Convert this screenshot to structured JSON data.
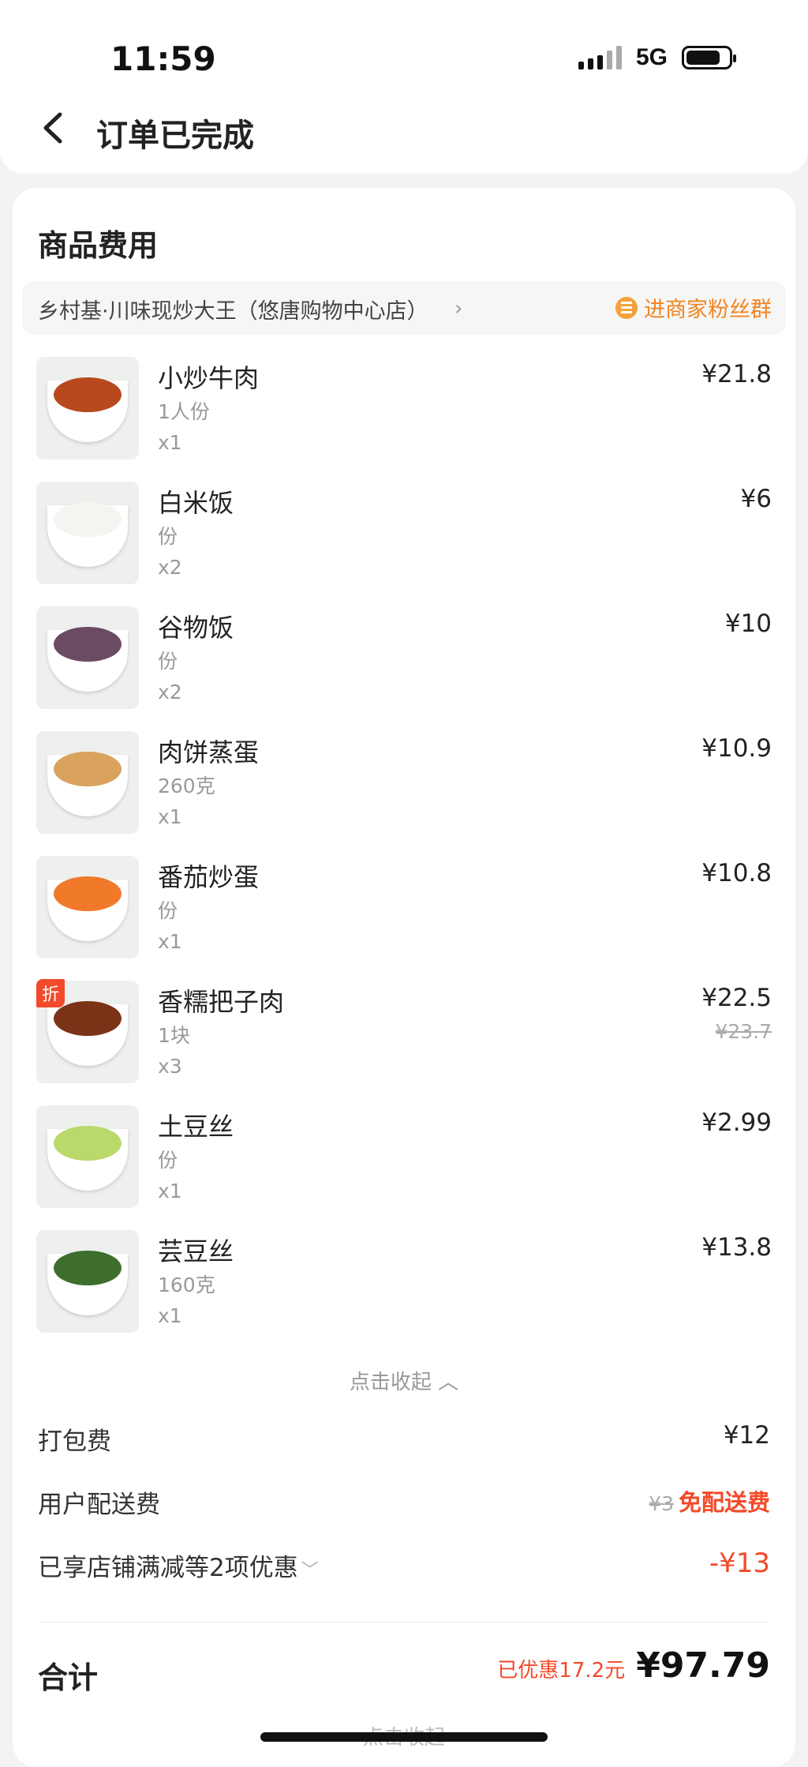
{
  "status_bar": {
    "time": "11:59",
    "network": "5G"
  },
  "nav": {
    "title": "订单已完成"
  },
  "section": {
    "title": "商品费用"
  },
  "shop": {
    "name": "乡村基·川味现炒大王（悠唐购物中心店）",
    "fans_link": "进商家粉丝群"
  },
  "items": [
    {
      "name": "小炒牛肉",
      "spec": "1人份",
      "qty": "x1",
      "price": "¥21.8",
      "food_color": "#b8491f"
    },
    {
      "name": "白米饭",
      "spec": "份",
      "qty": "x2",
      "price": "¥6",
      "food_color": "#f4f4f0"
    },
    {
      "name": "谷物饭",
      "spec": "份",
      "qty": "x2",
      "price": "¥10",
      "food_color": "#6b4a63"
    },
    {
      "name": "肉饼蒸蛋",
      "spec": "260克",
      "qty": "x1",
      "price": "¥10.9",
      "food_color": "#d9a35f"
    },
    {
      "name": "番茄炒蛋",
      "spec": "份",
      "qty": "x1",
      "price": "¥10.8",
      "food_color": "#f07a2a"
    },
    {
      "name": "香糯把子肉",
      "spec": "1块",
      "qty": "x3",
      "price": "¥22.5",
      "original_price": "¥23.7",
      "badge": "折",
      "food_color": "#7b3318"
    },
    {
      "name": "土豆丝",
      "spec": "份",
      "qty": "x1",
      "price": "¥2.99",
      "food_color": "#b9d96b"
    },
    {
      "name": "芸豆丝",
      "spec": "160克",
      "qty": "x1",
      "price": "¥13.8",
      "food_color": "#3e6e2e"
    }
  ],
  "collapse_label": "点击收起",
  "fees": {
    "packing_label": "打包费",
    "packing_value": "¥12",
    "delivery_label": "用户配送费",
    "delivery_original": "¥3",
    "delivery_value": "免配送费",
    "discount_label": "已享店铺满减等2项优惠",
    "discount_value": "-¥13"
  },
  "total": {
    "label": "合计",
    "saved": "已优惠17.2元",
    "amount": "¥97.79"
  },
  "bottom_collapse_label": "点击收起",
  "colors": {
    "accent_red": "#f24a2a",
    "accent_orange": "#f3831f"
  }
}
